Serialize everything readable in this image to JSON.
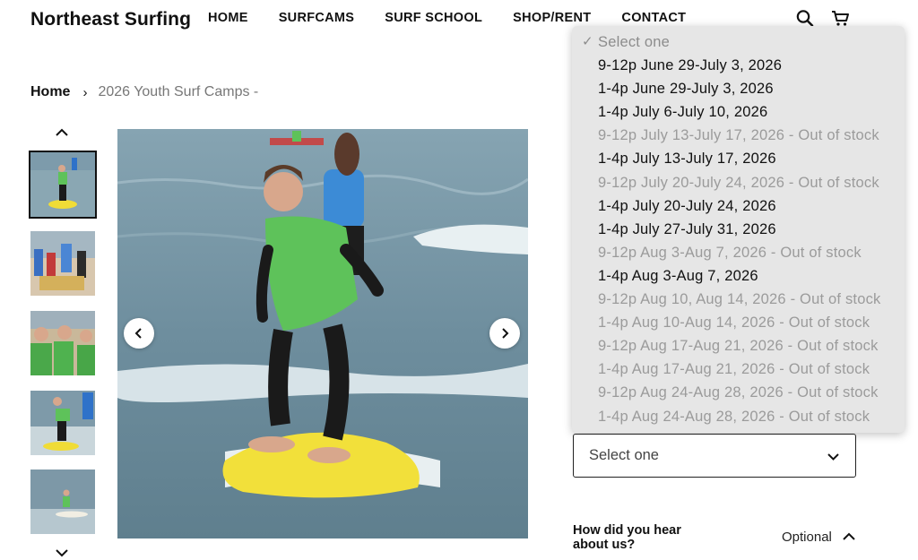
{
  "brand": "Northeast Surfing",
  "nav": [
    "HOME",
    "SURFCAMS",
    "SURF SCHOOL",
    "SHOP/RENT",
    "CONTACT"
  ],
  "icons": {
    "search": "search-icon",
    "cart": "cart-icon"
  },
  "breadcrumb": {
    "home": "Home",
    "separator": "›",
    "current": "2026 Youth Surf Camps -"
  },
  "dropdown": {
    "placeholder": "Select one",
    "options": [
      {
        "label": "9-12p June 29-July 3, 2026",
        "disabled": false
      },
      {
        "label": "1-4p June 29-July 3, 2026",
        "disabled": false
      },
      {
        "label": "1-4p July 6-July 10, 2026",
        "disabled": false
      },
      {
        "label": "9-12p July 13-July 17, 2026 - Out of stock",
        "disabled": true
      },
      {
        "label": "1-4p July 13-July 17, 2026",
        "disabled": false
      },
      {
        "label": "9-12p July 20-July 24, 2026 - Out of stock",
        "disabled": true
      },
      {
        "label": "1-4p July 20-July 24, 2026",
        "disabled": false
      },
      {
        "label": "1-4p July 27-July 31, 2026",
        "disabled": false
      },
      {
        "label": "9-12p Aug 3-Aug 7, 2026 - Out of stock",
        "disabled": true
      },
      {
        "label": "1-4p Aug 3-Aug 7, 2026",
        "disabled": false
      },
      {
        "label": "9-12p Aug 10, Aug 14, 2026 - Out of stock",
        "disabled": true
      },
      {
        "label": "1-4p Aug 10-Aug 14, 2026 - Out of stock",
        "disabled": true
      },
      {
        "label": "9-12p Aug 17-Aug 21, 2026 - Out of stock",
        "disabled": true
      },
      {
        "label": "1-4p Aug 17-Aug 21, 2026 - Out of stock",
        "disabled": true
      },
      {
        "label": "9-12p Aug 24-Aug 28, 2026 - Out of stock",
        "disabled": true
      },
      {
        "label": "1-4p Aug 24-Aug 28, 2026 - Out of stock",
        "disabled": true
      }
    ]
  },
  "select": {
    "value": "Select one"
  },
  "question": {
    "label": "How did you hear about us?",
    "optional": "Optional"
  },
  "colors": {
    "dropdown_bg": "#e6e6e6",
    "disabled_text": "#9b9b9b",
    "shirt_green": "#5ec25a",
    "board_yellow": "#f2e03a"
  }
}
